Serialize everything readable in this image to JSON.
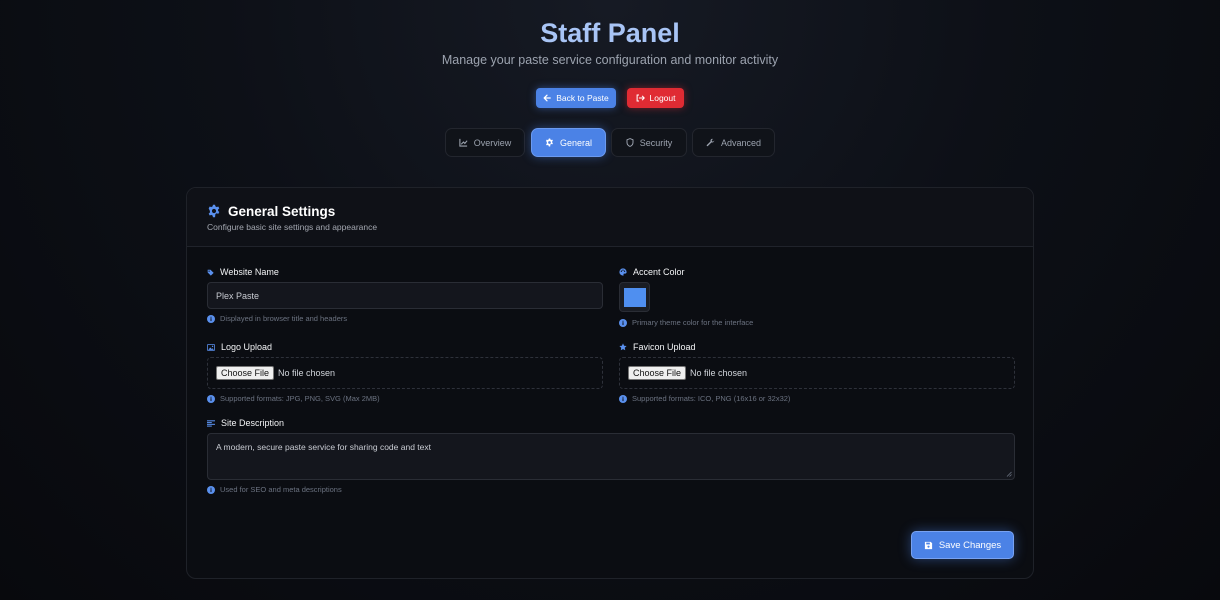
{
  "header": {
    "title": "Staff Panel",
    "subtitle": "Manage your paste service configuration and monitor activity",
    "back_label": "Back to Paste",
    "logout_label": "Logout"
  },
  "tabs": [
    {
      "label": "Overview",
      "icon": "chart-line-icon",
      "active": false
    },
    {
      "label": "General",
      "icon": "gear-icon",
      "active": true
    },
    {
      "label": "Security",
      "icon": "shield-icon",
      "active": false
    },
    {
      "label": "Advanced",
      "icon": "wrench-icon",
      "active": false
    }
  ],
  "card": {
    "title": "General Settings",
    "subtitle": "Configure basic site settings and appearance"
  },
  "fields": {
    "website_name": {
      "label": "Website Name",
      "value": "Plex Paste",
      "hint": "Displayed in browser title and headers"
    },
    "accent_color": {
      "label": "Accent Color",
      "value": "#4f8ff0",
      "hint": "Primary theme color for the interface"
    },
    "logo_upload": {
      "label": "Logo Upload",
      "button": "Choose File",
      "status": "No file chosen",
      "hint": "Supported formats: JPG, PNG, SVG (Max 2MB)"
    },
    "favicon_upload": {
      "label": "Favicon Upload",
      "button": "Choose File",
      "status": "No file chosen",
      "hint": "Supported formats: ICO, PNG (16x16 or 32x32)"
    },
    "site_description": {
      "label": "Site Description",
      "value": "A modern, secure paste service for sharing code and text",
      "hint": "Used for SEO and meta descriptions"
    }
  },
  "save_label": "Save Changes",
  "colors": {
    "accent": "#4b82e6",
    "danger": "#e02b33",
    "title": "#a8c4f5"
  }
}
